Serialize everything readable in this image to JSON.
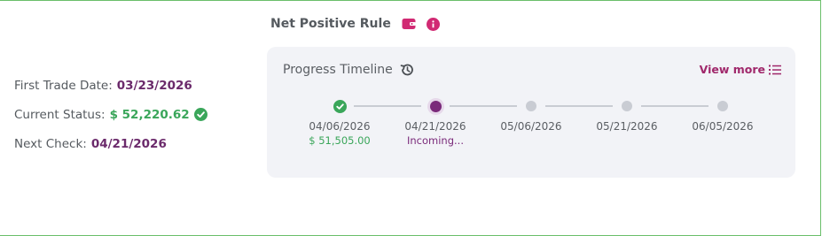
{
  "rule": {
    "title": "Net Positive Rule"
  },
  "summary": {
    "first_trade_label": "First Trade Date:",
    "first_trade_value": "03/23/2026",
    "status_label": "Current Status:",
    "status_value": "$ 52,220.62",
    "next_check_label": "Next Check:",
    "next_check_value": "04/21/2026"
  },
  "progress": {
    "title": "Progress Timeline",
    "view_more": "View more",
    "steps": [
      {
        "date": "04/06/2026",
        "sub": "$ 51,505.00",
        "state": "done"
      },
      {
        "date": "04/21/2026",
        "sub": "Incoming...",
        "state": "active"
      },
      {
        "date": "05/06/2026",
        "sub": "",
        "state": "future"
      },
      {
        "date": "05/21/2026",
        "sub": "",
        "state": "future"
      },
      {
        "date": "06/05/2026",
        "sub": "",
        "state": "future"
      }
    ]
  },
  "colors": {
    "border": "#6abf6a",
    "accent_purple": "#6b2a6b",
    "accent_pink": "#d12a73",
    "success": "#3aa65a"
  },
  "icons": [
    "wallet-icon",
    "info-icon",
    "check-circle-icon",
    "history-icon",
    "list-icon",
    "check-icon"
  ]
}
